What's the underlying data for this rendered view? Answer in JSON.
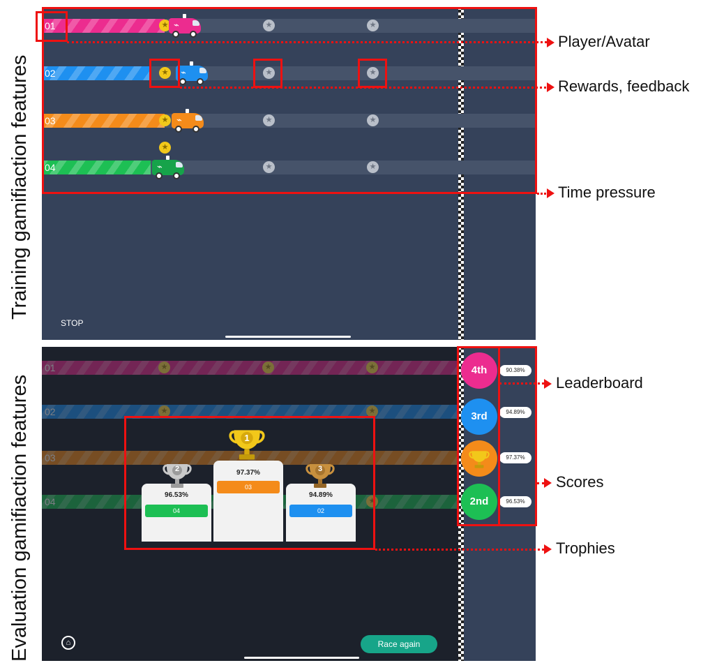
{
  "side_labels": {
    "top": "Training gamifiaction features",
    "bottom": "Evaluation gamifiaction features"
  },
  "annotations": {
    "player": "Player/Avatar",
    "rewards": "Rewards, feedback",
    "time": "Time pressure",
    "leaderboard": "Leaderboard",
    "scores": "Scores",
    "trophies": "Trophies"
  },
  "training": {
    "lanes": [
      {
        "num": "01",
        "color": "#ec2c8f",
        "progress": 0.29
      },
      {
        "num": "02",
        "color": "#1e90f0",
        "progress": 0.25
      },
      {
        "num": "03",
        "color": "#f48b1a",
        "progress": 0.26
      },
      {
        "num": "04",
        "color": "#1dbf54",
        "progress": 0.22
      }
    ],
    "stop_label": "STOP"
  },
  "evaluation": {
    "lanes": [
      {
        "num": "01",
        "color": "#ec2c8f"
      },
      {
        "num": "02",
        "color": "#1e90f0"
      },
      {
        "num": "03",
        "color": "#f48b1a"
      },
      {
        "num": "04",
        "color": "#1dbf54"
      }
    ],
    "podium": {
      "first": {
        "rank": "1",
        "score": "97.37%",
        "lane": "03",
        "color": "#f48b1a"
      },
      "second": {
        "rank": "2",
        "score": "96.53%",
        "lane": "04",
        "color": "#1dbf54"
      },
      "third": {
        "rank": "3",
        "score": "94.89%",
        "lane": "02",
        "color": "#1e90f0"
      }
    },
    "leaderboard": [
      {
        "rank": "4th",
        "score": "90.38%",
        "color": "#ec2c8f"
      },
      {
        "rank": "3rd",
        "score": "94.89%",
        "color": "#1e90f0"
      },
      {
        "rank": "trophy-icon",
        "score": "97.37%",
        "color": "#f48b1a"
      },
      {
        "rank": "2nd",
        "score": "96.53%",
        "color": "#1dbf54"
      }
    ],
    "race_again": "Race again"
  }
}
